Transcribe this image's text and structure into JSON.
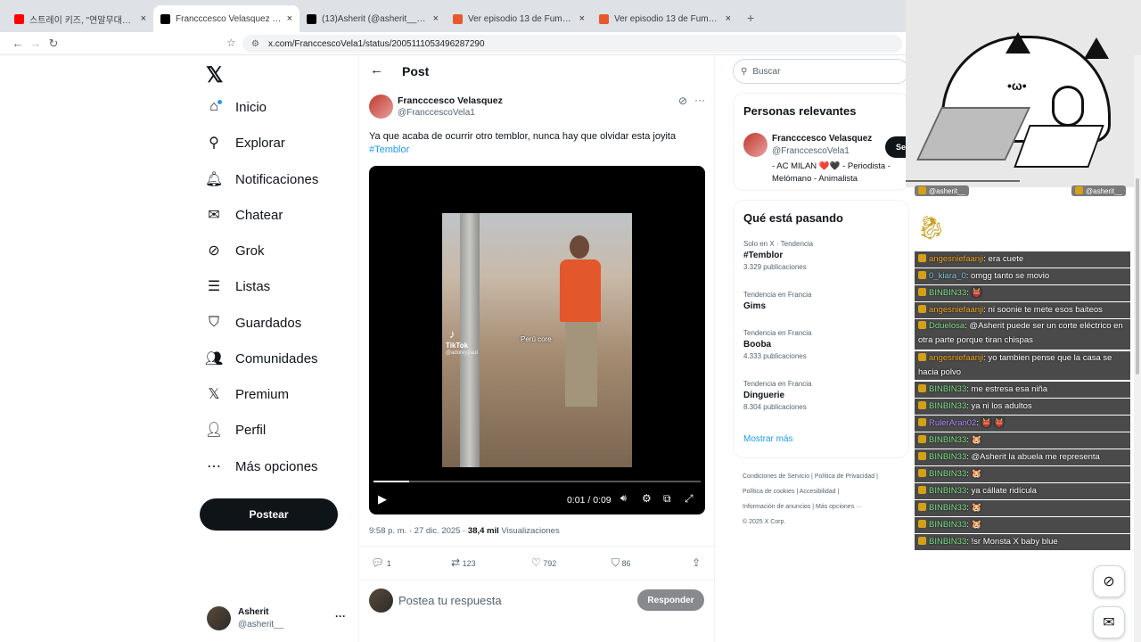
{
  "browser": {
    "tabs": [
      {
        "title": "스트레이 키즈, \"연말무대까지 파이팅",
        "icon": "youtube-icon",
        "color": "#ff0000"
      },
      {
        "title": "Francccesco Velasquez en X: \"Ya q",
        "icon": "x-icon",
        "color": "#000000",
        "active": true
      },
      {
        "title": "(13)Asherit (@asherit__) | TikTok",
        "icon": "tiktok-icon",
        "color": "#000000"
      },
      {
        "title": "Ver episodio 13 de Fumetsu no Anat",
        "icon": "anime-icon",
        "color": "#e8582c"
      },
      {
        "title": "Ver episodio 13 de Fumetsu no Anat",
        "icon": "anime-icon",
        "color": "#e8582c"
      }
    ],
    "url": "x.com/FranccescoVela1/status/2005111053496287290",
    "new_tab": "+"
  },
  "nav": {
    "items": [
      {
        "label": "Inicio",
        "icon": "home-icon",
        "glyph": "⌂"
      },
      {
        "label": "Explorar",
        "icon": "search-icon",
        "glyph": "⚲"
      },
      {
        "label": "Notificaciones",
        "icon": "bell-icon",
        "glyph": "🔔︎"
      },
      {
        "label": "Chatear",
        "icon": "mail-icon",
        "glyph": "✉"
      },
      {
        "label": "Grok",
        "icon": "grok-icon",
        "glyph": "⊘"
      },
      {
        "label": "Listas",
        "icon": "list-icon",
        "glyph": "☰"
      },
      {
        "label": "Guardados",
        "icon": "bookmark-icon",
        "glyph": "⛉"
      },
      {
        "label": "Comunidades",
        "icon": "people-icon",
        "glyph": "👥︎"
      },
      {
        "label": "Premium",
        "icon": "x-premium-icon",
        "glyph": "𝕏"
      },
      {
        "label": "Perfil",
        "icon": "person-icon",
        "glyph": "👤︎"
      },
      {
        "label": "Más opciones",
        "icon": "more-circle-icon",
        "glyph": "⋯"
      }
    ],
    "post_button": "Postear",
    "account": {
      "name": "Asherit",
      "handle": "@asherit__",
      "more": "···"
    }
  },
  "post": {
    "header": "Post",
    "author": "Francccesco Velasquez",
    "handle": "@FranccescoVela1",
    "text": "Ya que acaba de ocurrir otro temblor, nunca hay que olvidar esta joyita",
    "hashtag": "#Temblor",
    "video": {
      "time": "0:01 / 0:09",
      "progress": 0.11,
      "tiktok_label": "TikTok",
      "tiktok_user": "@adoreypaul",
      "caption": "Perú core"
    },
    "timestamp": "9:58 p. m. · 27 dic. 2025 · ",
    "views": "38,4 mil",
    "views_label": "Visualizaciones",
    "replies": "1",
    "reposts": "123",
    "likes": "792",
    "bookmarks": "86",
    "reply_placeholder": "Postea tu respuesta",
    "reply_button": "Responder"
  },
  "sidebar": {
    "search_placeholder": "Buscar",
    "relevant_title": "Personas relevantes",
    "person": {
      "name": "Francccesco Velasquez",
      "handle": "@FranccescoVela1",
      "bio_1": "- AC MILAN ❤️🖤 - Periodista -",
      "bio_2": "Melómano - Animalista",
      "follow": "Se"
    },
    "trending_title": "Qué está pasando",
    "trends": [
      {
        "context": "Solo en X · Tendencia",
        "name": "#Temblor",
        "count": "3.329 publicaciones"
      },
      {
        "context": "Tendencia en Francia",
        "name": "Gims",
        "count": ""
      },
      {
        "context": "Tendencia en Francia",
        "name": "Booba",
        "count": "4.333 publicaciones"
      },
      {
        "context": "Tendencia en Francia",
        "name": "Dinguerie",
        "count": "8.304 publicaciones"
      }
    ],
    "show_more": "Mostrar más",
    "footer": {
      "line1": [
        "Condiciones de Servicio",
        "Política de Privacidad"
      ],
      "line2": [
        "Política de cookies",
        "Accesibilidad"
      ],
      "line3": [
        "Información de anuncios",
        "Más opciones ···"
      ],
      "copyright": "© 2025 X Corp."
    }
  },
  "stream_overlay": {
    "tag_left": "@asherit__",
    "tag_right": "@asherit__",
    "chat": [
      {
        "user": "angesniefaanji",
        "msg": ": era cuete",
        "color": "#f5a623"
      },
      {
        "user": "0_kiara_0",
        "msg": ": omgg tanto se movio",
        "color": "#7ec8e3"
      },
      {
        "user": "BINBIN33",
        "msg": ": 👹",
        "color": "#7ee08a"
      },
      {
        "user": "angesniefaanji",
        "msg": ": ni soonie te mete esos baiteos",
        "color": "#f5a623"
      },
      {
        "user": "Dduelosa",
        "msg": ": @Asherit puede ser un corte eléctrico en otra parte porque tiran chispas",
        "color": "#7ee08a"
      },
      {
        "user": "angesniefaanji",
        "msg": ": yo tambien pense que la casa se hacia polvo",
        "color": "#f5a623"
      },
      {
        "user": "BINBIN33",
        "msg": ": me estresa esa niña",
        "color": "#7ee08a"
      },
      {
        "user": "BINBIN33",
        "msg": ": ya ni los adultos",
        "color": "#7ee08a"
      },
      {
        "user": "RulerAran02",
        "msg": ": 👹 👹",
        "color": "#b08cff"
      },
      {
        "user": "BINBIN33",
        "msg": ": 🐹",
        "color": "#7ee08a"
      },
      {
        "user": "BINBIN33",
        "msg": ": @Asherit la abuela me representa",
        "color": "#7ee08a"
      },
      {
        "user": "BINBIN33",
        "msg": ": 🐹",
        "color": "#7ee08a"
      },
      {
        "user": "BINBIN33",
        "msg": ": ya cállate ridícula",
        "color": "#7ee08a"
      },
      {
        "user": "BINBIN33",
        "msg": ": 🐹",
        "color": "#7ee08a"
      },
      {
        "user": "BINBIN33",
        "msg": ": 🐹",
        "color": "#7ee08a"
      },
      {
        "user": "BINBIN33",
        "msg": ": !sr Monsta X baby blue",
        "color": "#7ee08a"
      }
    ]
  },
  "colors": {
    "accent": "#1d9bf0",
    "text": "#0f1419",
    "muted": "#536471"
  }
}
